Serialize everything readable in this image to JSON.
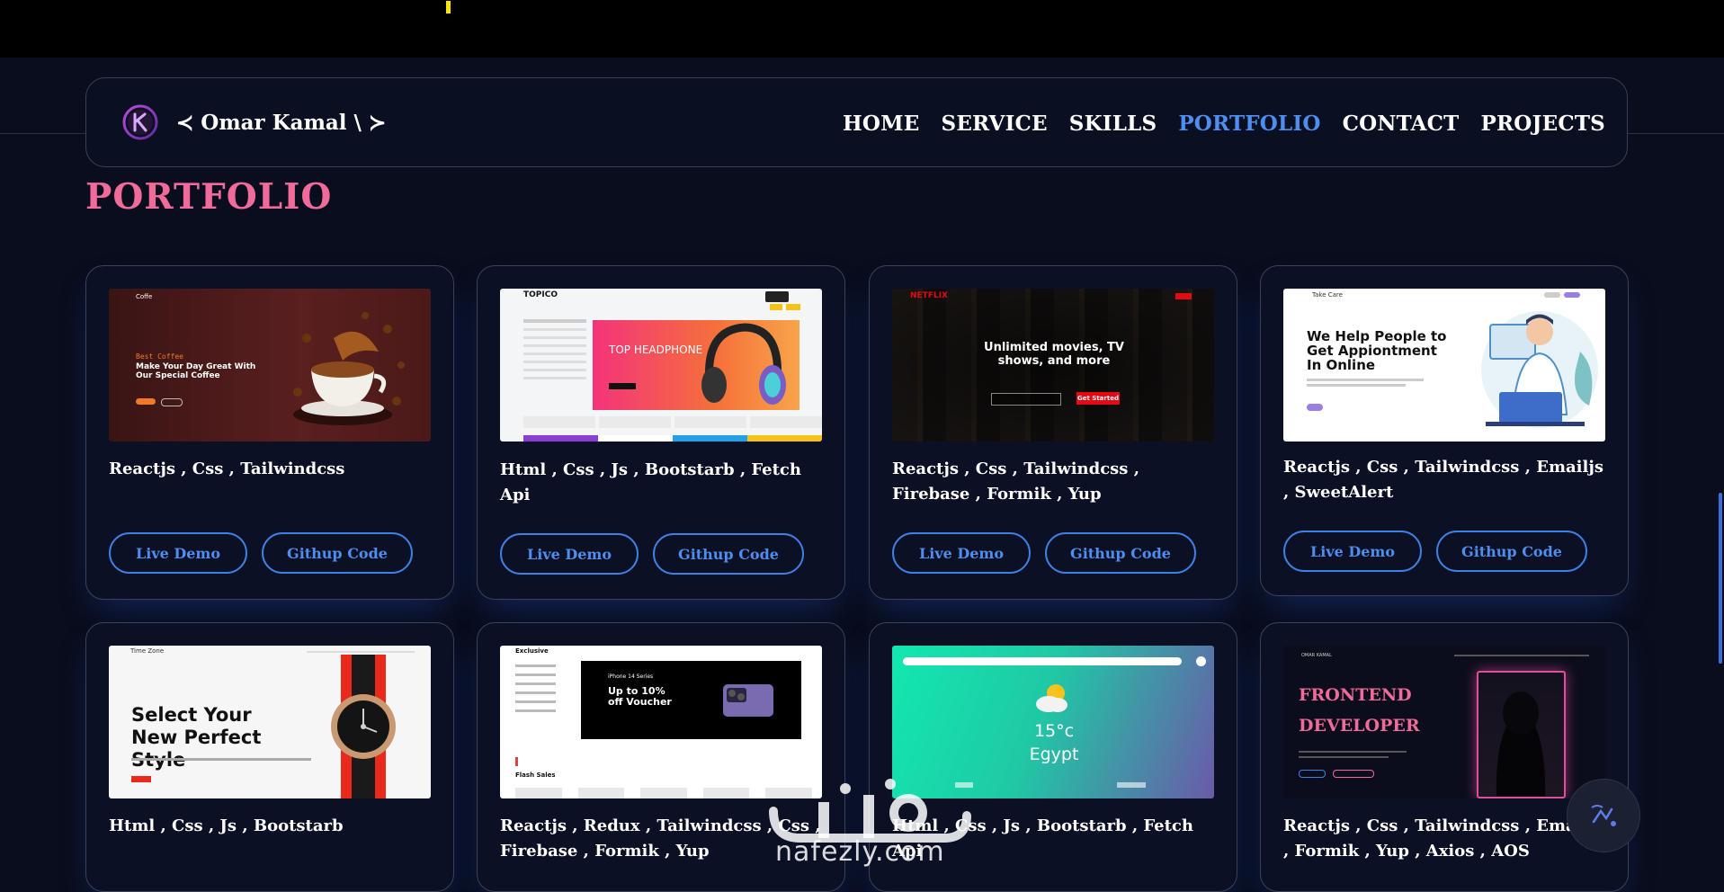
{
  "header": {
    "brand": "≺ Omar Kamal \\ ≻",
    "nav": [
      {
        "label": "HOME"
      },
      {
        "label": "SERVICE"
      },
      {
        "label": "SKILLS"
      },
      {
        "label": "PORTFOLIO"
      },
      {
        "label": "CONTACT"
      },
      {
        "label": "PROJECTS"
      }
    ],
    "active_nav": "PORTFOLIO"
  },
  "section": {
    "title": "PORTFOLIO"
  },
  "projects": [
    {
      "tech": "Reactjs , Css , Tailwindcss",
      "demo": "Live Demo",
      "code": "Githup Code",
      "preview": {
        "brand": "Coffe",
        "kicker": "Best Coffee",
        "headline": "Make Your Day Great With Our Special Coffee"
      }
    },
    {
      "tech": "Html , Css , Js , Bootstarb , Fetch Api",
      "demo": "Live Demo",
      "code": "Githup Code",
      "preview": {
        "brand": "TOPICO",
        "headline": "TOP HEADPHONE"
      }
    },
    {
      "tech": "Reactjs , Css , Tailwindcss , Firebase , Formik , Yup",
      "demo": "Live Demo",
      "code": "Githup Code",
      "preview": {
        "brand": "NETFLIX",
        "headline": "Unlimited movies, TV shows, and more",
        "cta": "Get Started"
      }
    },
    {
      "tech": "Reactjs , Css , Tailwindcss , Emailjs , SweetAlert",
      "demo": "Live Demo",
      "code": "Githup Code",
      "preview": {
        "brand": "Take Care",
        "headline": "We Help People to Get Appiontment In Online"
      }
    },
    {
      "tech": "Html , Css , Js , Bootstarb",
      "preview": {
        "brand": "Time Zone",
        "headline": "Select Your New Perfect Style"
      }
    },
    {
      "tech": "Reactjs , Redux , Tailwindcss , Css , Firebase , Formik , Yup",
      "preview": {
        "brand": "Exclusive",
        "headline": "Up to 10% off Voucher",
        "sub": "iPhone 14 Series",
        "label": "Flash Sales"
      }
    },
    {
      "tech": "Html , Css , Js , Bootstarb , Fetch Api",
      "preview": {
        "temp": "15°c",
        "city": "Egypt"
      }
    },
    {
      "tech": "Reactjs , Css , Tailwindcss , Emailjs , Formik , Yup , Axios , AOS",
      "preview": {
        "brand": "OMAR KAMAL",
        "line1": "FRONTEND",
        "line2": "DEVELOPER"
      }
    }
  ],
  "watermark": {
    "text": "nafezly.com"
  },
  "colors": {
    "accent": "#4e8ef0",
    "title": "#f06b99",
    "background": "#090d1d"
  }
}
